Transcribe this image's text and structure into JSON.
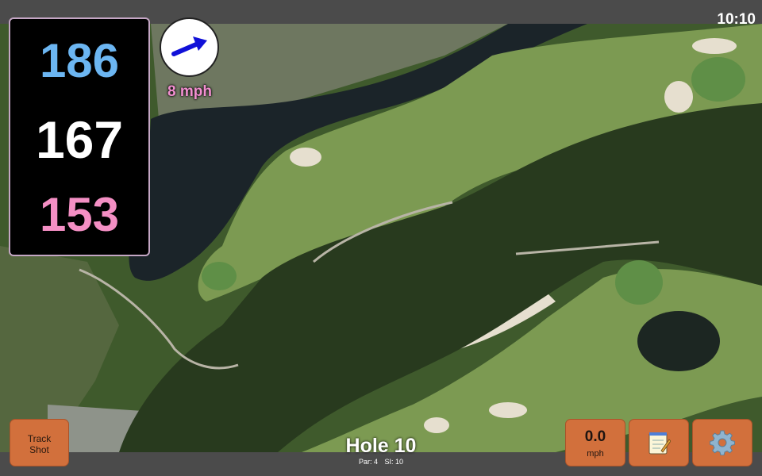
{
  "status": {
    "time": "10:10"
  },
  "distances": {
    "back": "186",
    "middle": "167",
    "front": "153"
  },
  "wind": {
    "speed_label": "8 mph",
    "direction": "blowing toward upper-right"
  },
  "hole": {
    "title": "Hole 10",
    "par_label": "Par: 4",
    "si_label": "SI: 10"
  },
  "buttons": {
    "track_shot_line1": "Track",
    "track_shot_line2": "Shot",
    "wind_value": "0.0",
    "wind_unit": "mph",
    "notes_icon": "notepad-icon",
    "settings_icon": "gear-icon"
  },
  "colors": {
    "back_distance": "#6cb6f2",
    "middle_distance": "#ffffff",
    "front_distance": "#f48fc4",
    "wind_arrow": "#1010d8",
    "button": "#d2703c"
  }
}
